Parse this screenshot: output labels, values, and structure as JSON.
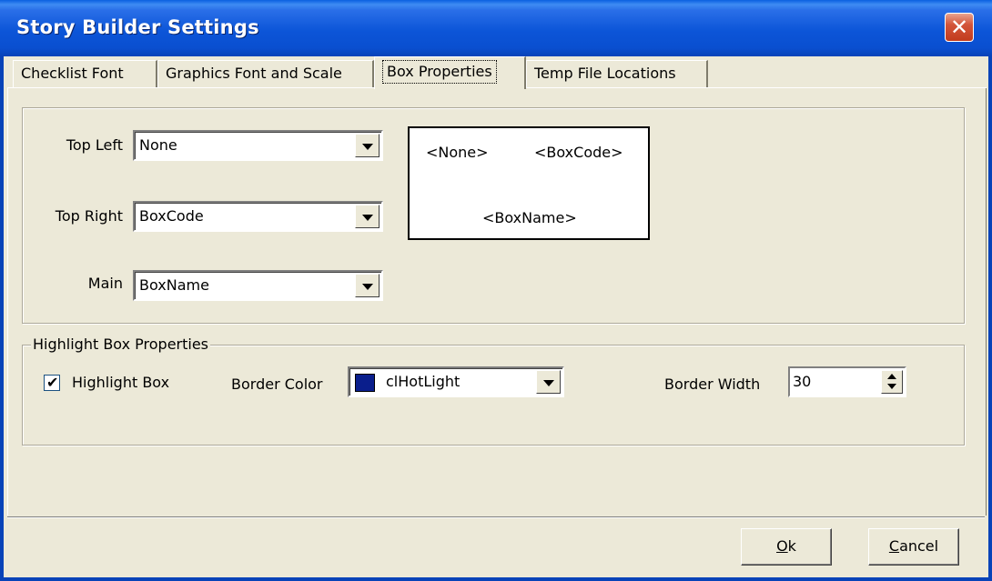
{
  "window": {
    "title": "Story Builder Settings",
    "close_glyph": "✕"
  },
  "tabs": [
    {
      "label": "Checklist Font",
      "active": false
    },
    {
      "label": "Graphics Font and Scale",
      "active": false
    },
    {
      "label": "Box Properties",
      "active": true
    },
    {
      "label": "Temp File Locations",
      "active": false
    }
  ],
  "box_properties": {
    "top_left": {
      "label": "Top Left",
      "value": "None"
    },
    "top_right": {
      "label": "Top Right",
      "value": "BoxCode"
    },
    "main": {
      "label": "Main",
      "value": "BoxName"
    },
    "preview": {
      "top_left": "<None>",
      "top_right": "<BoxCode>",
      "main": "<BoxName>"
    }
  },
  "highlight": {
    "legend": "Highlight Box Properties",
    "checkbox_label": "Highlight Box",
    "checked": true,
    "check_glyph": "✔",
    "border_color_label": "Border Color",
    "border_color_value": "clHotLight",
    "border_color_swatch": "#0a1e8c",
    "border_width_label": "Border Width",
    "border_width_value": "30"
  },
  "buttons": {
    "ok_mnemonic": "O",
    "ok_rest": "k",
    "cancel_mnemonic": "C",
    "cancel_rest": "ancel"
  },
  "colors": {
    "titlebar": "#0a4fd0",
    "face": "#ece9d8",
    "close": "#c23b1d"
  }
}
